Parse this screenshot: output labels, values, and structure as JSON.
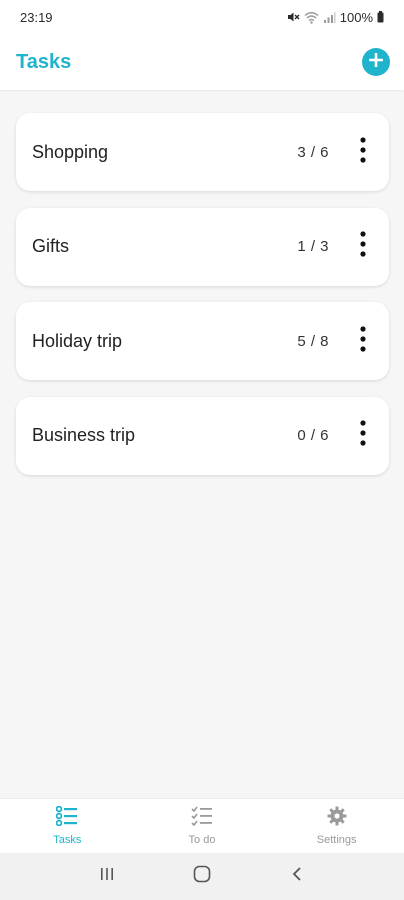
{
  "status_bar": {
    "time": "23:19",
    "battery": "100%"
  },
  "header": {
    "title": "Tasks",
    "accent_color": "#1fb4cc"
  },
  "tasks": [
    {
      "name": "Shopping",
      "count": "3 / 6"
    },
    {
      "name": "Gifts",
      "count": "1 / 3"
    },
    {
      "name": "Holiday trip",
      "count": "5 / 8"
    },
    {
      "name": "Business trip",
      "count": "0 / 6"
    }
  ],
  "bottom_nav": {
    "items": [
      {
        "label": "Tasks",
        "icon": "task-list-icon",
        "active": true
      },
      {
        "label": "To do",
        "icon": "checklist-icon",
        "active": false
      },
      {
        "label": "Settings",
        "icon": "gear-icon",
        "active": false
      }
    ]
  },
  "system_nav": {
    "icons": [
      "recents-icon",
      "home-icon",
      "back-icon"
    ]
  }
}
